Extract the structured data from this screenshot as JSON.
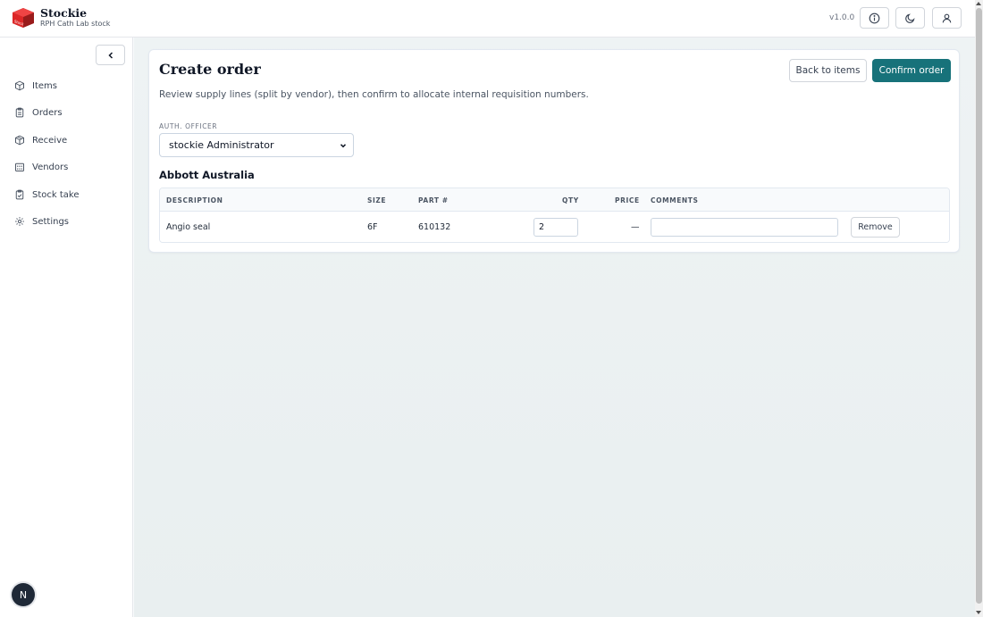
{
  "app": {
    "name": "Stockie",
    "subtitle": "RPH Cath Lab stock",
    "version": "v1.0.0",
    "logo_text": "Stockie"
  },
  "header": {
    "icons": [
      "info-icon",
      "moon-icon",
      "user-icon"
    ]
  },
  "sidebar": {
    "items": [
      {
        "label": "Items",
        "icon": "box-icon"
      },
      {
        "label": "Orders",
        "icon": "clipboard-icon"
      },
      {
        "label": "Receive",
        "icon": "package-icon"
      },
      {
        "label": "Vendors",
        "icon": "building-icon"
      },
      {
        "label": "Stock take",
        "icon": "clipboard-check-icon"
      },
      {
        "label": "Settings",
        "icon": "gear-icon"
      }
    ],
    "avatar_letter": "N"
  },
  "page": {
    "title": "Create order",
    "subtitle": "Review supply lines (split by vendor), then confirm to allocate internal requisition numbers.",
    "back_label": "Back to items",
    "confirm_label": "Confirm order",
    "officer_label": "AUTH. OFFICER",
    "officer_value": "stockie Administrator"
  },
  "vendor": {
    "name": "Abbott Australia",
    "columns": {
      "description": "DESCRIPTION",
      "size": "SIZE",
      "part": "PART #",
      "qty": "QTY",
      "price": "PRICE",
      "comments": "COMMENTS"
    },
    "rows": [
      {
        "description": "Angio seal",
        "size": "6F",
        "part": "610132",
        "qty": "2",
        "price": "—",
        "comments": "",
        "remove_label": "Remove"
      }
    ]
  },
  "colors": {
    "accent": "#17727a",
    "logo": "#b91c1c"
  }
}
